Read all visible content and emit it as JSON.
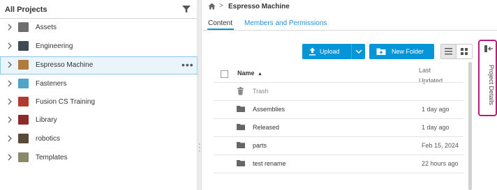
{
  "left_panel": {
    "title": "All Projects",
    "projects": [
      {
        "label": "Assets",
        "thumb_color": "#6e6e6e"
      },
      {
        "label": "Engineering",
        "thumb_color": "#3f4a55"
      },
      {
        "label": "Espresso Machine",
        "thumb_color": "#b07b3e",
        "selected": true
      },
      {
        "label": "Fasteners",
        "thumb_color": "#4fa3c9"
      },
      {
        "label": "Fusion CS Training",
        "thumb_color": "#b23a2e"
      },
      {
        "label": "Library",
        "thumb_color": "#8c2a2a"
      },
      {
        "label": "robotics",
        "thumb_color": "#5a4a3a"
      },
      {
        "label": "Templates",
        "thumb_color": "#8a8a6a"
      }
    ],
    "more_label": "•••"
  },
  "breadcrumb": {
    "separator": ">",
    "current": "Espresso Machine"
  },
  "tabs": {
    "content": "Content",
    "members": "Members and Permissions"
  },
  "toolbar": {
    "upload_label": "Upload",
    "new_folder_label": "New Folder"
  },
  "table": {
    "col_name": "Name",
    "sort_arrow": "▲",
    "col_updated": "Last Updated",
    "rows": [
      {
        "name": "Trash",
        "date": "",
        "kind": "trash"
      },
      {
        "name": "Assemblies",
        "date": "1 day ago",
        "kind": "folder"
      },
      {
        "name": "Released",
        "date": "1 day ago",
        "kind": "folder"
      },
      {
        "name": "parts",
        "date": "Feb 15, 2024",
        "kind": "folder"
      },
      {
        "name": "test rename",
        "date": "22 hours ago",
        "kind": "folder"
      }
    ]
  },
  "details_panel": {
    "label": "Project Details"
  },
  "colors": {
    "accent": "#0696d7",
    "link": "#2a8dd4",
    "highlight_border": "#b81c76",
    "selected_bg": "#eaf4fb"
  }
}
